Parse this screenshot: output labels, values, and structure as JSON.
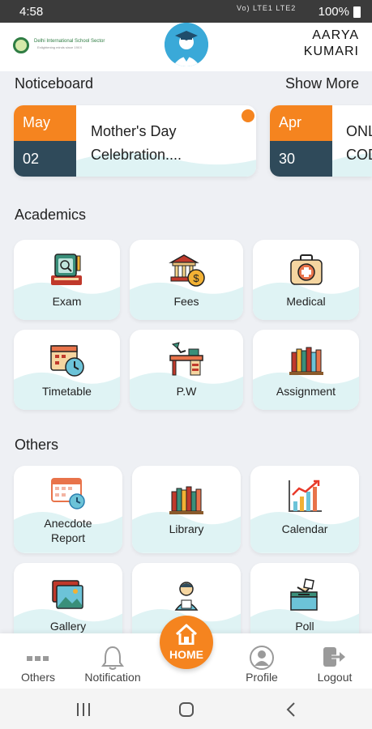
{
  "status_bar": {
    "time": "4:58",
    "signal_text": "Vo) LTE1 LTE2",
    "battery": "100%"
  },
  "header": {
    "user_name_line1": "AARYA",
    "user_name_line2": "KUMARI",
    "logo_text": "Delhi International School Sector",
    "logo_tagline": "Enlightening minds since 19XX"
  },
  "noticeboard": {
    "title": "Noticeboard",
    "show_more": "Show More",
    "items": [
      {
        "month": "May",
        "day": "02",
        "title_line1": "Mother's Day",
        "title_line2": "Celebration...."
      },
      {
        "month": "Apr",
        "day": "30",
        "title_line1": "ONL",
        "title_line2": "COD"
      }
    ]
  },
  "academics": {
    "title": "Academics",
    "tiles": [
      {
        "label": "Exam",
        "icon": "exam-icon"
      },
      {
        "label": "Fees",
        "icon": "fees-icon"
      },
      {
        "label": "Medical",
        "icon": "medical-icon"
      },
      {
        "label": "Timetable",
        "icon": "timetable-icon"
      },
      {
        "label": "P.W",
        "icon": "desk-icon"
      },
      {
        "label": "Assignment",
        "icon": "books-icon"
      }
    ]
  },
  "others": {
    "title": "Others",
    "tiles": [
      {
        "label_line1": "Anecdote",
        "label_line2": "Report",
        "icon": "anecdote-calendar-icon"
      },
      {
        "label": "Library",
        "icon": "library-icon"
      },
      {
        "label": "Calendar",
        "icon": "calendar-chart-icon"
      },
      {
        "label": "Gallery",
        "icon": "gallery-icon"
      },
      {
        "label": "",
        "icon": "student-icon"
      },
      {
        "label": "Poll",
        "icon": "poll-icon"
      }
    ]
  },
  "bottom_nav": {
    "others": "Others",
    "notification": "Notification",
    "home": "HOME",
    "profile": "Profile",
    "logout": "Logout"
  },
  "colors": {
    "accent": "#f5841f",
    "dark": "#2f4a5a",
    "wave": "#dff3f4"
  }
}
